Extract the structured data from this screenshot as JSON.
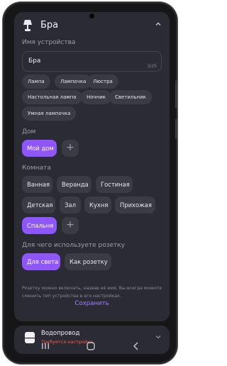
{
  "header": {
    "title": "Бра",
    "icon": "lamp-icon"
  },
  "device_name": {
    "label": "Имя устройства",
    "value": "Бра",
    "counter": "3/25"
  },
  "suggestions": [
    "Лампа",
    "Лампочка",
    "Люстра",
    "Настольная лампа",
    "Ночник",
    "Светильник",
    "Умная лампочка"
  ],
  "home": {
    "label": "Дом",
    "options": [
      "Мой дом"
    ],
    "selected": "Мой дом"
  },
  "room": {
    "label": "Комната",
    "options": [
      "Ванная",
      "Веранда",
      "Гостиная",
      "Детская",
      "Зал",
      "Кухня",
      "Прихожая",
      "Спальня"
    ],
    "selected": "Спальня"
  },
  "usage": {
    "label": "Для чего используете розетку",
    "options": [
      "Для света",
      "Как розетку"
    ],
    "selected": "Для света",
    "hint": "Розетку можно включать, назвав её имя. Вы всегда можете сменить тип устройства в его настройках."
  },
  "save_label": "Сохранить",
  "next_device": {
    "title": "Водопровод",
    "status": "Требуется настройка",
    "icon": "water-device-icon"
  },
  "colors": {
    "accent": "#8f55ff",
    "card_bg": "#2b2b33",
    "chip_bg": "#3b3b45",
    "error": "#ff5b4e",
    "screen_bg": "#161619"
  }
}
